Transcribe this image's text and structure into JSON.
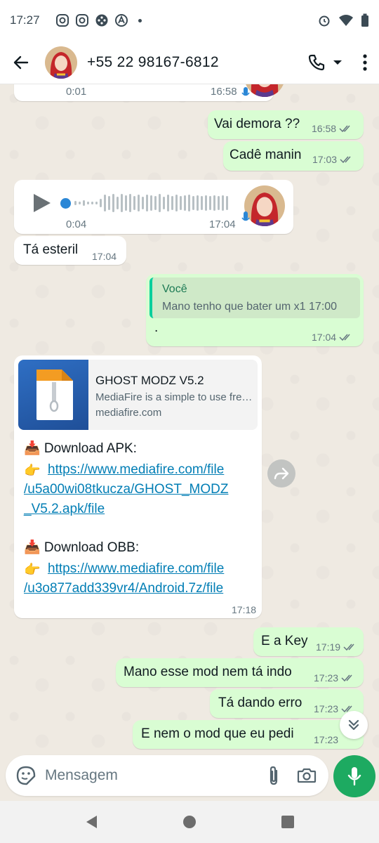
{
  "status_bar": {
    "time": "17:27"
  },
  "header": {
    "contact_name": "+55 22 98167-6812"
  },
  "messages": {
    "voice_top": {
      "duration": "0:01",
      "time": "16:58"
    },
    "out1": {
      "text": "Vai demora ??",
      "time": "16:58"
    },
    "out2": {
      "text": "Cadê manin",
      "time": "17:03"
    },
    "voice2": {
      "duration": "0:04",
      "time": "17:04"
    },
    "in_esteril": {
      "text": "Tá esteril",
      "time": "17:04"
    },
    "out_reply": {
      "quote_author": "Você",
      "quote_text": "Mano tenho que bater um x1 17:00",
      "text": ".",
      "time": "17:04"
    },
    "in_link": {
      "card_title": "GHOST MODZ V5.2",
      "card_desc": "MediaFire is a simple to use free service...",
      "card_domain": "mediafire.com",
      "apk_label": "📥 Download APK:",
      "apk_pointer": "👉",
      "apk_url_1": "https://www.mediafire.com/file",
      "apk_url_2": "/u5a00wi08tkucza/GHOST_MODZ",
      "apk_url_3": "_V5.2.apk/file",
      "obb_label": "📥 Download OBB:",
      "obb_pointer": "👉",
      "obb_url_1": "https://www.mediafire.com/file",
      "obb_url_2": "/u3o877add339vr4/Android.7z/file",
      "time": "17:18"
    },
    "out3": {
      "text": "E a Key",
      "time": "17:19"
    },
    "out4": {
      "text": "Mano esse mod nem tá indo",
      "time": "17:23"
    },
    "out5": {
      "text": "Tá dando erro",
      "time": "17:23"
    },
    "out6": {
      "text": "E nem o mod que eu pedi",
      "time": "17:23"
    }
  },
  "composer": {
    "placeholder": "Mensagem"
  },
  "colors": {
    "outgoing_bubble": "#d9fdd3",
    "incoming_bubble": "#ffffff",
    "accent_green": "#1daa61",
    "link_blue": "#027eb5",
    "read_tick": "#667781"
  }
}
